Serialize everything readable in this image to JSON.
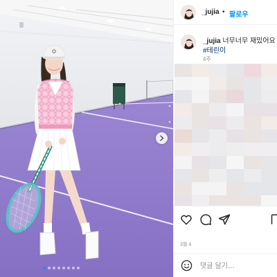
{
  "post": {
    "username": "_jujia",
    "header_separator": "•",
    "follow_label": "팔로우",
    "caption_text": "너무너무 재밌어요 ㅎ",
    "hashtag": "#테린이",
    "time_ago": "4주",
    "likes_text": "3월 4",
    "comment_placeholder": "댓글 달기...",
    "carousel": {
      "slide_count": 8,
      "current_slide": 1
    }
  },
  "icons": {
    "next": "chevron-right-icon",
    "like": "heart-icon",
    "comment": "comment-icon",
    "share": "paper-plane-icon",
    "save": "bookmark-icon",
    "emoji": "smiley-icon"
  },
  "colors": {
    "accent_blue": "#0095f6",
    "hashtag_blue": "#00376b",
    "court_purple": "#8d77c9",
    "vest_pink": "#f2a7c3"
  }
}
